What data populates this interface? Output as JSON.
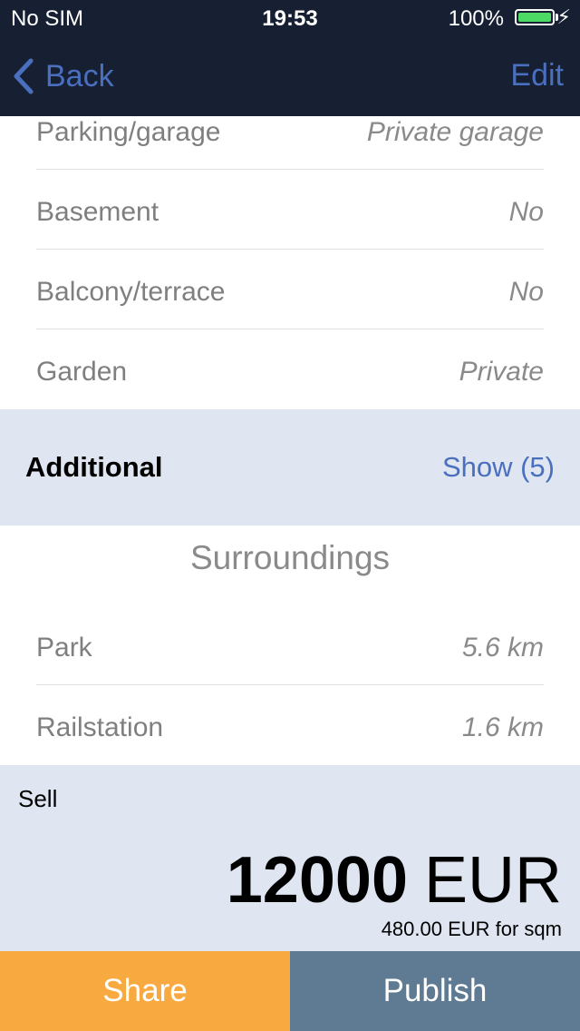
{
  "status_bar": {
    "carrier": "No SIM",
    "time": "19:53",
    "battery": "100%",
    "battery_level": 1.0
  },
  "nav": {
    "back_label": "Back",
    "edit_label": "Edit"
  },
  "features": [
    {
      "label": "Parking/garage",
      "value": "Private garage"
    },
    {
      "label": "Basement",
      "value": "No"
    },
    {
      "label": "Balcony/terrace",
      "value": "No"
    },
    {
      "label": "Garden",
      "value": "Private"
    }
  ],
  "additional": {
    "title": "Additional",
    "action": "Show (5)"
  },
  "surroundings": {
    "title": "Surroundings",
    "items": [
      {
        "label": "Park",
        "value": "5.6 km"
      },
      {
        "label": "Railstation",
        "value": "1.6 km"
      }
    ]
  },
  "price": {
    "type": "Sell",
    "amount": "12000",
    "currency": "EUR",
    "per_sqm": "480.00 EUR for sqm"
  },
  "actions": {
    "share": "Share",
    "publish": "Publish"
  },
  "colors": {
    "bar": "#172033",
    "accent": "#4a6fbf",
    "panel": "#dfe6f1",
    "share": "#f8aa40",
    "publish": "#5f7b93",
    "battery": "#4cd964"
  }
}
